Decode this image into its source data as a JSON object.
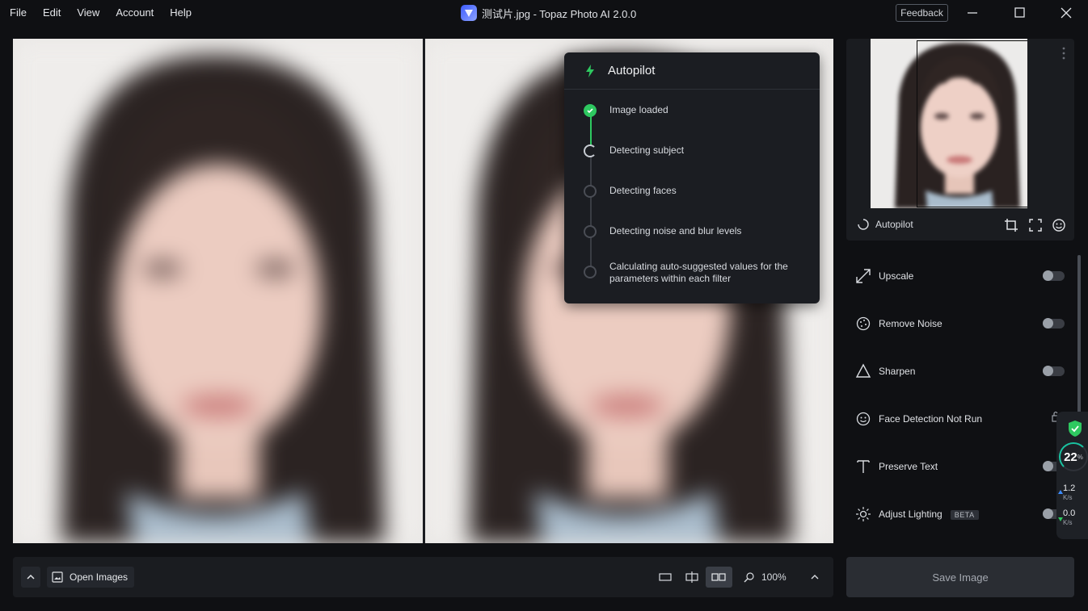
{
  "menu": [
    "File",
    "Edit",
    "View",
    "Account",
    "Help"
  ],
  "window": {
    "title": "测试片.jpg - Topaz Photo AI 2.0.0",
    "feedback": "Feedback"
  },
  "autopilot_panel": {
    "title": "Autopilot",
    "steps": [
      {
        "label": "Image loaded",
        "state": "done"
      },
      {
        "label": "Detecting subject",
        "state": "in-progress"
      },
      {
        "label": "Detecting faces",
        "state": "pending"
      },
      {
        "label": "Detecting noise and blur levels",
        "state": "pending"
      },
      {
        "label": "Calculating auto-suggested values for the parameters within each filter",
        "state": "pending"
      }
    ]
  },
  "bottombar": {
    "open_images": "Open Images",
    "zoom": "100%"
  },
  "thumbnail": {
    "autopilot_label": "Autopilot"
  },
  "filters": [
    {
      "label": "Upscale",
      "icon": "upscale-icon",
      "enabled": false
    },
    {
      "label": "Remove Noise",
      "icon": "remove-noise-icon",
      "enabled": false
    },
    {
      "label": "Sharpen",
      "icon": "sharpen-icon",
      "enabled": false
    },
    {
      "label": "Face Detection Not Run",
      "icon": "face-icon",
      "enabled": false
    },
    {
      "label": "Preserve Text",
      "icon": "text-icon",
      "enabled": false
    },
    {
      "label": "Adjust Lighting",
      "badge": "BETA",
      "icon": "lighting-icon",
      "enabled": false
    }
  ],
  "netmon": {
    "percent": "22",
    "percent_sign": "%",
    "upload": "1.2",
    "upload_unit": "K/s",
    "download": "0.0",
    "download_unit": "K/s"
  },
  "save_button": "Save Image",
  "colors": {
    "accent_green": "#2ec860",
    "background": "#0f1013",
    "panel": "#1a1c20"
  }
}
